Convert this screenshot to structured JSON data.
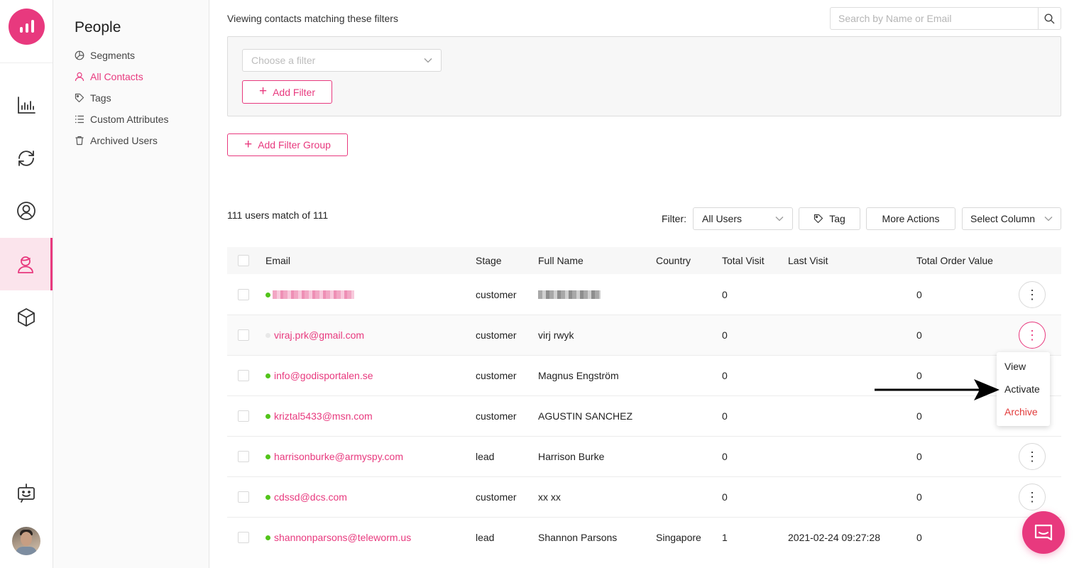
{
  "nav": {
    "title": "People",
    "items": [
      {
        "label": "Segments",
        "icon": "pie-chart-icon",
        "active": false
      },
      {
        "label": "All Contacts",
        "icon": "user-icon",
        "active": true
      },
      {
        "label": "Tags",
        "icon": "tag-icon",
        "active": false
      },
      {
        "label": "Custom Attributes",
        "icon": "list-icon",
        "active": false
      },
      {
        "label": "Archived Users",
        "icon": "trash-icon",
        "active": false
      }
    ]
  },
  "rail": {
    "items": [
      "analytics-icon",
      "sync-icon",
      "contact-circle-icon",
      "people-icon",
      "cube-icon"
    ],
    "bottom": [
      "bot-icon"
    ]
  },
  "filters": {
    "heading": "Viewing contacts matching these filters",
    "search_placeholder": "Search by Name or Email",
    "choose_placeholder": "Choose a filter",
    "add_filter": "Add Filter",
    "add_filter_group": "Add Filter Group"
  },
  "toolbar": {
    "match_text": "111 users match of 111",
    "filter_label": "Filter:",
    "filter_value": "All Users",
    "tag": "Tag",
    "more_actions": "More Actions",
    "select_column": "Select Column"
  },
  "table": {
    "columns": [
      "Email",
      "Stage",
      "Full Name",
      "Country",
      "Total Visit",
      "Last Visit",
      "Total Order Value"
    ],
    "rows": [
      {
        "email": "",
        "stage": "customer",
        "name": "",
        "country": "",
        "visits": "0",
        "last_visit": "",
        "order_value": "0",
        "online": true
      },
      {
        "email": "viraj.prk@gmail.com",
        "stage": "customer",
        "name": "virj rwyk",
        "country": "",
        "visits": "0",
        "last_visit": "",
        "order_value": "0",
        "online": false
      },
      {
        "email": "info@godisportalen.se",
        "stage": "customer",
        "name": "Magnus Engström",
        "country": "",
        "visits": "0",
        "last_visit": "",
        "order_value": "0",
        "online": true
      },
      {
        "email": "kriztal5433@msn.com",
        "stage": "customer",
        "name": "AGUSTIN SANCHEZ",
        "country": "",
        "visits": "0",
        "last_visit": "",
        "order_value": "0",
        "online": true
      },
      {
        "email": "harrisonburke@armyspy.com",
        "stage": "lead",
        "name": "Harrison Burke",
        "country": "",
        "visits": "0",
        "last_visit": "",
        "order_value": "0",
        "online": true
      },
      {
        "email": "cdssd@dcs.com",
        "stage": "customer",
        "name": "xx xx",
        "country": "",
        "visits": "0",
        "last_visit": "",
        "order_value": "0",
        "online": true
      },
      {
        "email": "shannonparsons@teleworm.us",
        "stage": "lead",
        "name": "Shannon Parsons",
        "country": "Singapore",
        "visits": "1",
        "last_visit": "2021-02-24 09:27:28",
        "order_value": "0",
        "online": true
      }
    ]
  },
  "row_menu": {
    "items": [
      "View",
      "Activate",
      "Archive"
    ]
  },
  "colors": {
    "accent": "#e8397e",
    "online": "#52c41a",
    "danger": "#e23b3b"
  }
}
